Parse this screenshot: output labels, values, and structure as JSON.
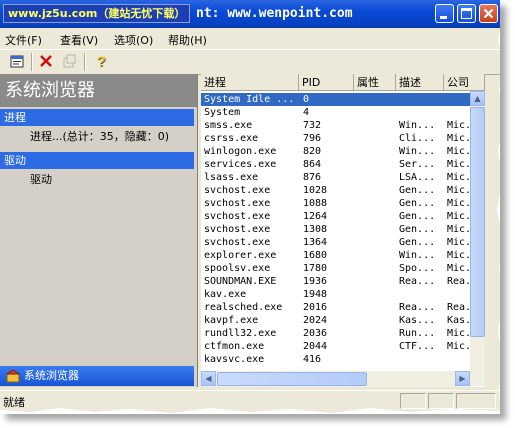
{
  "window": {
    "watermark": "www.jz5u.com（建站无忧下载）",
    "title": "nt: www.wenpoint.com"
  },
  "menu": [
    {
      "label": "文件(F)"
    },
    {
      "label": "查看(V)"
    },
    {
      "label": "选项(O)"
    },
    {
      "label": "帮助(H)"
    }
  ],
  "toolbar": {
    "icons": [
      "properties-icon",
      "delete-icon",
      "disabled-icon",
      "help-icon"
    ]
  },
  "left": {
    "header": "系统浏览器",
    "sections": [
      {
        "title": "进程",
        "item": "进程...(总计：35，隐藏：0)"
      },
      {
        "title": "驱动",
        "item": "驱动"
      }
    ],
    "footer": "系统浏览器"
  },
  "table": {
    "columns": [
      "进程",
      "PID",
      "属性",
      "描述",
      "公司"
    ],
    "rows": [
      {
        "name": "System Idle ...",
        "pid": "0",
        "attr": "",
        "desc": "",
        "company": "",
        "selected": true
      },
      {
        "name": "System",
        "pid": "4",
        "attr": "",
        "desc": "",
        "company": ""
      },
      {
        "name": "smss.exe",
        "pid": "732",
        "attr": "",
        "desc": "Win...",
        "company": "Mic..."
      },
      {
        "name": "csrss.exe",
        "pid": "796",
        "attr": "",
        "desc": "Cli...",
        "company": "Mic..."
      },
      {
        "name": "winlogon.exe",
        "pid": "820",
        "attr": "",
        "desc": "Win...",
        "company": "Mic..."
      },
      {
        "name": "services.exe",
        "pid": "864",
        "attr": "",
        "desc": "Ser...",
        "company": "Mic..."
      },
      {
        "name": "lsass.exe",
        "pid": "876",
        "attr": "",
        "desc": "LSA...",
        "company": "Mic..."
      },
      {
        "name": "svchost.exe",
        "pid": "1028",
        "attr": "",
        "desc": "Gen...",
        "company": "Mic..."
      },
      {
        "name": "svchost.exe",
        "pid": "1088",
        "attr": "",
        "desc": "Gen...",
        "company": "Mic..."
      },
      {
        "name": "svchost.exe",
        "pid": "1264",
        "attr": "",
        "desc": "Gen...",
        "company": "Mic..."
      },
      {
        "name": "svchost.exe",
        "pid": "1308",
        "attr": "",
        "desc": "Gen...",
        "company": "Mic..."
      },
      {
        "name": "svchost.exe",
        "pid": "1364",
        "attr": "",
        "desc": "Gen...",
        "company": "Mic..."
      },
      {
        "name": "explorer.exe",
        "pid": "1680",
        "attr": "",
        "desc": "Win...",
        "company": "Mic..."
      },
      {
        "name": "spoolsv.exe",
        "pid": "1780",
        "attr": "",
        "desc": "Spo...",
        "company": "Mic..."
      },
      {
        "name": "SOUNDMAN.EXE",
        "pid": "1936",
        "attr": "",
        "desc": "Rea...",
        "company": "Rea..."
      },
      {
        "name": "kav.exe",
        "pid": "1948",
        "attr": "",
        "desc": "",
        "company": ""
      },
      {
        "name": "realsched.exe",
        "pid": "2016",
        "attr": "",
        "desc": "Rea...",
        "company": "Rea..."
      },
      {
        "name": "kavpf.exe",
        "pid": "2024",
        "attr": "",
        "desc": "Kas...",
        "company": "Kas..."
      },
      {
        "name": "rundll32.exe",
        "pid": "2036",
        "attr": "",
        "desc": "Run...",
        "company": "Mic..."
      },
      {
        "name": "ctfmon.exe",
        "pid": "2044",
        "attr": "",
        "desc": "CTF...",
        "company": "Mic..."
      },
      {
        "name": "kavsvc.exe",
        "pid": "416",
        "attr": "",
        "desc": "",
        "company": ""
      }
    ]
  },
  "status": {
    "text": "就绪"
  },
  "colors": {
    "titlebar": "#0a4ad6",
    "selection": "#316ac5",
    "section": "#2d6be4",
    "left_header": "#8a8a88"
  }
}
